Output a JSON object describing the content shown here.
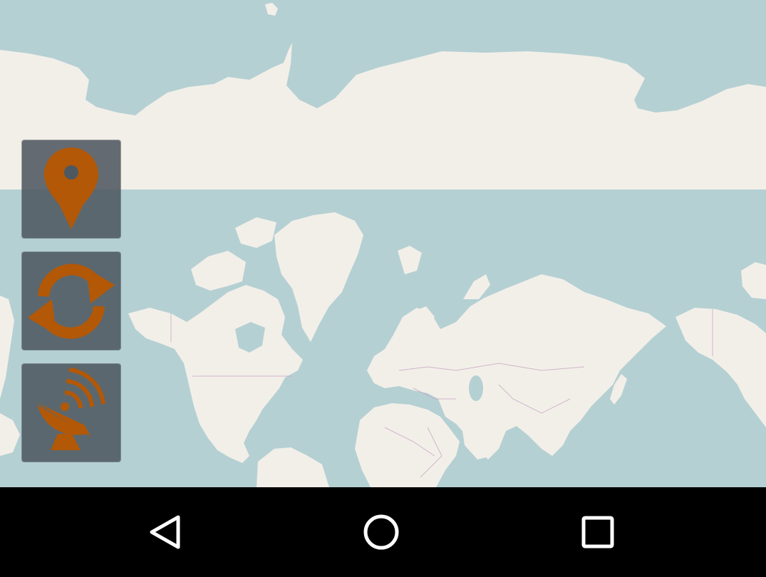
{
  "map": {
    "water_color": "#b5d0d3",
    "land_color": "#f2efe9",
    "border_color": "#c8a7c2"
  },
  "controls": {
    "accent_color": "#b35806",
    "items": [
      {
        "name": "my-location-button",
        "icon": "map-pin-icon"
      },
      {
        "name": "refresh-button",
        "icon": "refresh-arrows-icon"
      },
      {
        "name": "satellite-button",
        "icon": "satellite-dish-icon"
      }
    ]
  },
  "navbar": {
    "buttons": [
      {
        "name": "back-button",
        "icon": "back-triangle-icon"
      },
      {
        "name": "home-button",
        "icon": "home-circle-icon"
      },
      {
        "name": "recents-button",
        "icon": "recents-square-icon"
      }
    ]
  }
}
